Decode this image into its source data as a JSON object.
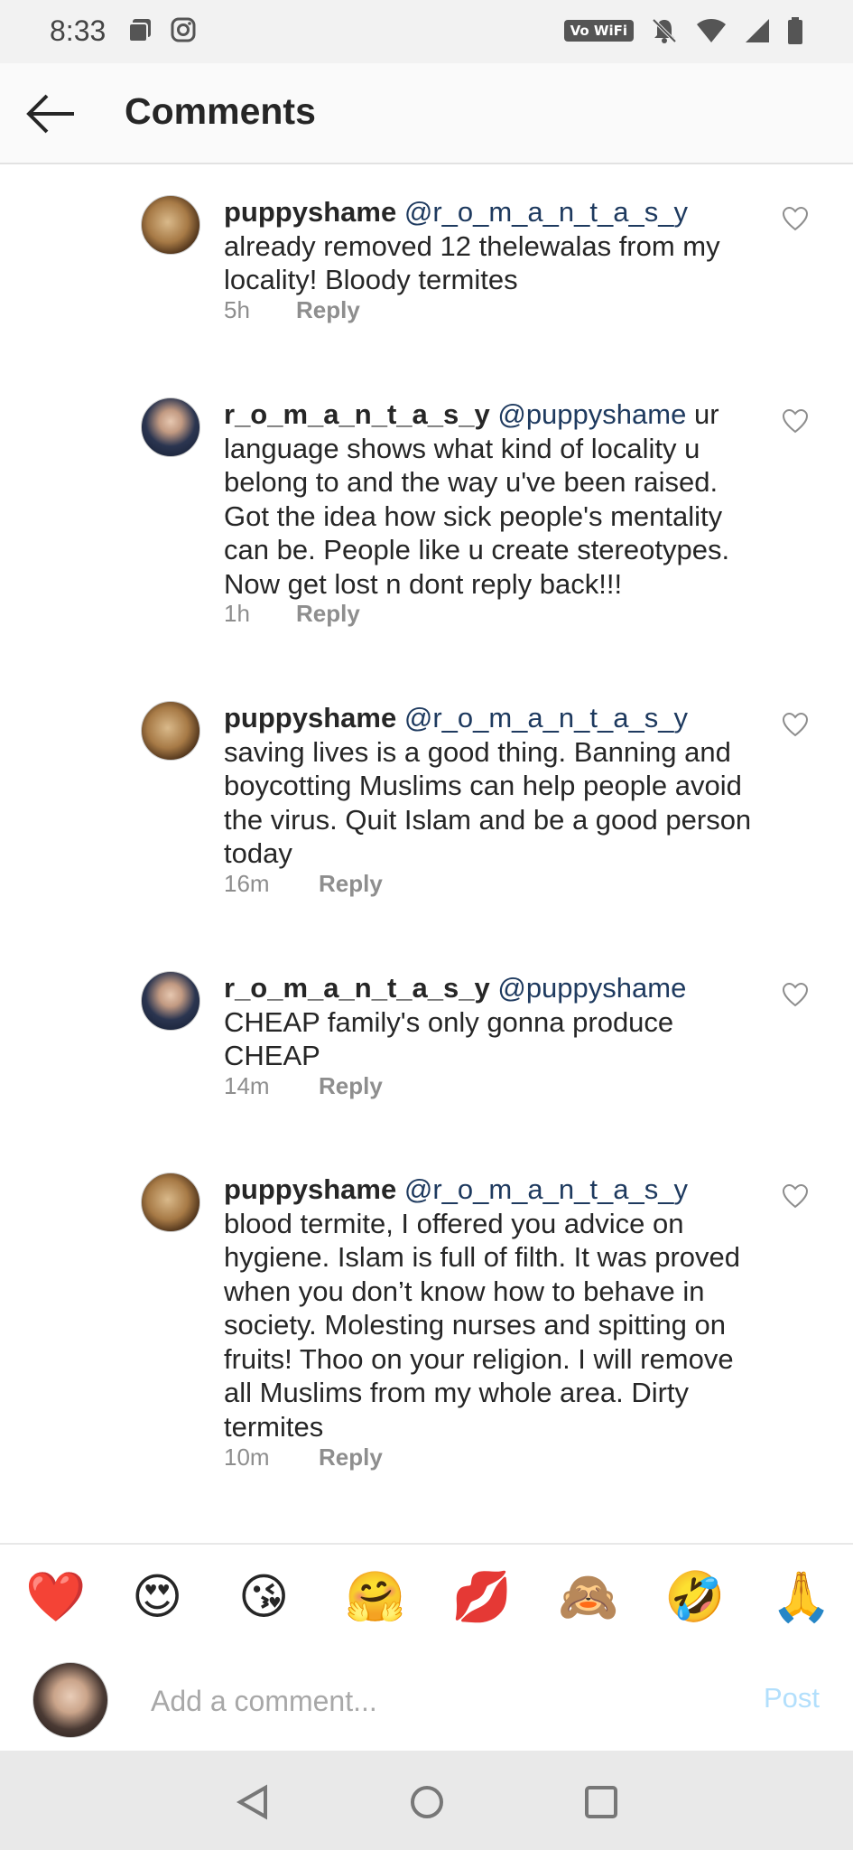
{
  "status_bar": {
    "time": "8:33",
    "volte_label": "Vo WiFi",
    "icons": [
      "gallery-icon",
      "instagram-icon",
      "volte-wifi-icon",
      "notifications-muted-icon",
      "wifi-icon",
      "signal-icon",
      "battery-icon"
    ]
  },
  "header": {
    "title": "Comments",
    "back_icon": "arrow-left-icon"
  },
  "comments": [
    {
      "username": "puppyshame",
      "mention": "@r_o_m_a_n_t_a_s_y",
      "text": "already removed 12 thelewalas from my locality! Bloody termites",
      "time": "5h",
      "reply_label": "Reply",
      "avatar": "puppyshame-avatar"
    },
    {
      "username": "r_o_m_a_n_t_a_s_y",
      "mention": "@puppyshame",
      "text": "ur language shows what kind of locality u belong to and the way u've been raised. Got the idea how sick people's mentality can be. People like u create stereotypes. Now get lost n dont reply back!!!",
      "time": "1h",
      "reply_label": "Reply",
      "avatar": "romantasy-avatar"
    },
    {
      "username": "puppyshame",
      "mention": "@r_o_m_a_n_t_a_s_y",
      "text": "saving lives is a good thing. Banning and boycotting Muslims can help people avoid the virus. Quit Islam and be a good person today",
      "time": "16m",
      "reply_label": "Reply",
      "avatar": "puppyshame-avatar"
    },
    {
      "username": "r_o_m_a_n_t_a_s_y",
      "mention": "@puppyshame",
      "text": "CHEAP family's only gonna produce CHEAP",
      "time": "14m",
      "reply_label": "Reply",
      "avatar": "romantasy-avatar"
    },
    {
      "username": "puppyshame",
      "mention": "@r_o_m_a_n_t_a_s_y",
      "text": "blood termite, I offered you advice on hygiene. Islam is full of filth. It was proved when you don’t know how to behave in society. Molesting nurses and spitting on fruits! Thoo on your religion. I will remove all Muslims from my whole area. Dirty termites",
      "time": "10m",
      "reply_label": "Reply",
      "avatar": "puppyshame-avatar"
    }
  ],
  "emoji_bar": [
    "❤️",
    "😍",
    "😘",
    "🤗",
    "💋",
    "🙈",
    "🤣",
    "🙏"
  ],
  "composer": {
    "placeholder": "Add a comment...",
    "post_label": "Post",
    "post_color": "#b2dffc"
  },
  "nav_bar": {
    "icons": [
      "back-triangle-icon",
      "home-circle-icon",
      "recents-square-icon"
    ]
  },
  "colors": {
    "mention": "#1e3a5f",
    "meta": "#8e8e8e",
    "text": "#262626"
  }
}
